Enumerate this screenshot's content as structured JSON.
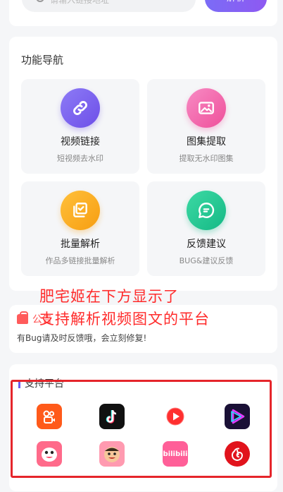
{
  "search": {
    "placeholder": "请输入链接地址",
    "button_label": "解析"
  },
  "nav": {
    "title": "功能导航",
    "tiles": [
      {
        "title": "视频链接",
        "subtitle": "短视频去水印",
        "icon": "link-icon",
        "color": "#7a5cf0"
      },
      {
        "title": "图集提取",
        "subtitle": "提取无水印图集",
        "icon": "image-icon",
        "color": "#f05aa3"
      },
      {
        "title": "批量解析",
        "subtitle": "作品多链接批量解析",
        "icon": "batch-icon",
        "color": "#f8a51d"
      },
      {
        "title": "反馈建议",
        "subtitle": "BUG&建议反馈",
        "icon": "chat-icon",
        "color": "#18be89"
      }
    ]
  },
  "annotation": {
    "line1": "肥宅姬在下方显示了",
    "line2": "支持解析视频图文的平台"
  },
  "notice": {
    "title": "公告",
    "text": "有Bug请及时反馈哦，会立刻修复!"
  },
  "platforms": {
    "title": "支持平台",
    "items": [
      {
        "name": "kuaishou",
        "icon": "kuaishou-icon"
      },
      {
        "name": "douyin",
        "icon": "tiktok-icon"
      },
      {
        "name": "video-play",
        "icon": "play-icon"
      },
      {
        "name": "video-app",
        "icon": "video-icon"
      },
      {
        "name": "pipixia",
        "icon": "pipixia-icon"
      },
      {
        "name": "zuiyou",
        "icon": "face-icon"
      },
      {
        "name": "bilibili",
        "icon": "bilibili-icon",
        "label": "bilibili"
      },
      {
        "name": "netease-music",
        "icon": "netease-icon"
      }
    ]
  }
}
